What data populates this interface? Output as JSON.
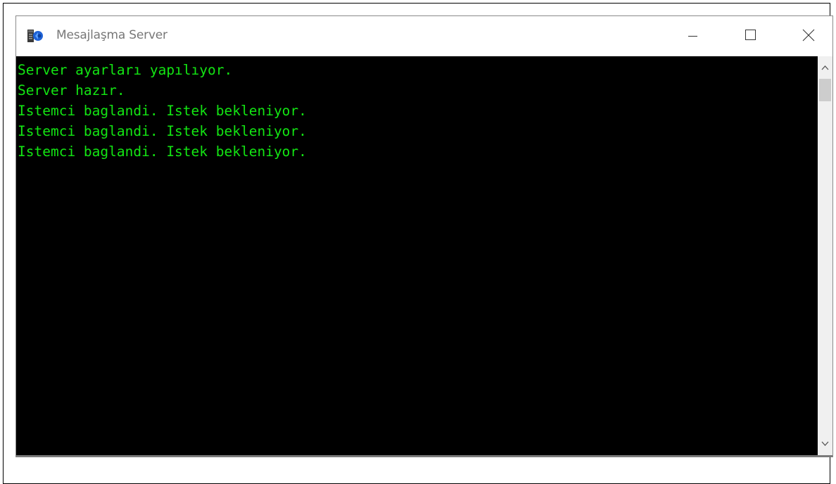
{
  "window": {
    "title": "Mesajlaşma Server",
    "icon": "console-app-icon",
    "controls": {
      "minimize_icon": "minimize-icon",
      "maximize_icon": "maximize-icon",
      "close_icon": "close-icon"
    }
  },
  "console": {
    "background": "#000000",
    "text_color": "#13e513",
    "lines": [
      "Server ayarları yapılıyor.",
      "Server hazır.",
      "Istemci baglandi. Istek bekleniyor.",
      "Istemci baglandi. Istek bekleniyor.",
      "Istemci baglandi. Istek bekleniyor."
    ]
  },
  "scrollbar": {
    "up_icon": "chevron-up-icon",
    "down_icon": "chevron-down-icon"
  }
}
